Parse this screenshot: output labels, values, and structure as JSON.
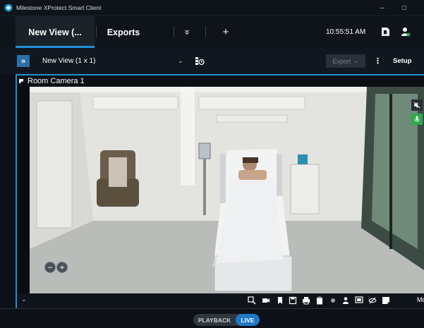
{
  "window": {
    "title": "Milestone XProtect Smart Client",
    "minimize_glyph": "–",
    "maximize_glyph": "□"
  },
  "tabs": {
    "active_label": "New View (...",
    "exports_label": "Exports",
    "more_tabs_glyph": "»",
    "add_tab_glyph": "+",
    "clock": "10:55:51 AM"
  },
  "viewbar": {
    "view_name": "New View (1 x 1)",
    "export_label": "Export",
    "setup_label": "Setup",
    "kebab_glyph": "⋮"
  },
  "camera": {
    "title": "Room Camera 1",
    "zoom_out": "−",
    "zoom_in": "+"
  },
  "camera_footer": {
    "more_label": "Mor"
  },
  "bottom": {
    "playback_label": "PLAYBACK",
    "live_label": "LIVE",
    "active_mode": "LIVE"
  },
  "colors": {
    "accent": "#1e90d6",
    "live": "#1e78c8",
    "mic_badge": "#2eaa4a"
  },
  "icons": [
    "milestone-logo-icon",
    "bookmark-tab-icon",
    "user-status-icon",
    "layout-icon",
    "search-camera-icon",
    "record-icon",
    "bookmark-icon",
    "save-icon",
    "print-icon",
    "clipboard-icon",
    "dot-icon",
    "person-icon",
    "monitor-icon",
    "eye-off-icon",
    "note-icon",
    "speaker-off-icon",
    "microphone-icon"
  ]
}
